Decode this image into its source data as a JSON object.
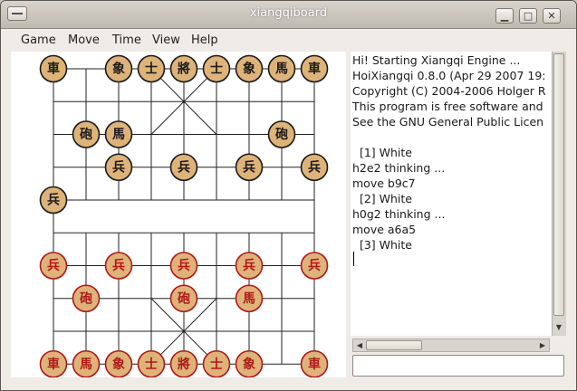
{
  "window": {
    "title": "xiangqiboard"
  },
  "menus": [
    "Game",
    "Move",
    "Time",
    "View",
    "Help"
  ],
  "title_buttons": {
    "minimize": "▁",
    "maximize": "□",
    "close": "✕"
  },
  "board": {
    "columns": 9,
    "rows": 10,
    "colors": {
      "piece_fill": "#deb37a",
      "black_side": "#1a1a1a",
      "red_side": "#b01818"
    },
    "black_pieces": [
      {
        "char": "車",
        "col": 0,
        "row": 0
      },
      {
        "char": "象",
        "col": 2,
        "row": 0
      },
      {
        "char": "士",
        "col": 3,
        "row": 0
      },
      {
        "char": "將",
        "col": 4,
        "row": 0
      },
      {
        "char": "士",
        "col": 5,
        "row": 0
      },
      {
        "char": "象",
        "col": 6,
        "row": 0
      },
      {
        "char": "馬",
        "col": 7,
        "row": 0
      },
      {
        "char": "車",
        "col": 8,
        "row": 0
      },
      {
        "char": "砲",
        "col": 1,
        "row": 2
      },
      {
        "char": "馬",
        "col": 2,
        "row": 2
      },
      {
        "char": "砲",
        "col": 7,
        "row": 2
      },
      {
        "char": "兵",
        "col": 2,
        "row": 3
      },
      {
        "char": "兵",
        "col": 4,
        "row": 3
      },
      {
        "char": "兵",
        "col": 6,
        "row": 3
      },
      {
        "char": "兵",
        "col": 8,
        "row": 3
      },
      {
        "char": "兵",
        "col": 0,
        "row": 4
      }
    ],
    "red_pieces": [
      {
        "char": "兵",
        "col": 0,
        "row": 6
      },
      {
        "char": "兵",
        "col": 2,
        "row": 6
      },
      {
        "char": "兵",
        "col": 4,
        "row": 6
      },
      {
        "char": "兵",
        "col": 6,
        "row": 6
      },
      {
        "char": "兵",
        "col": 8,
        "row": 6
      },
      {
        "char": "砲",
        "col": 1,
        "row": 7
      },
      {
        "char": "砲",
        "col": 4,
        "row": 7
      },
      {
        "char": "馬",
        "col": 6,
        "row": 7
      },
      {
        "char": "車",
        "col": 0,
        "row": 9
      },
      {
        "char": "馬",
        "col": 1,
        "row": 9
      },
      {
        "char": "象",
        "col": 2,
        "row": 9
      },
      {
        "char": "士",
        "col": 3,
        "row": 9
      },
      {
        "char": "將",
        "col": 4,
        "row": 9
      },
      {
        "char": "士",
        "col": 5,
        "row": 9
      },
      {
        "char": "象",
        "col": 6,
        "row": 9
      },
      {
        "char": "車",
        "col": 8,
        "row": 9
      }
    ]
  },
  "log": {
    "lines": [
      "Hi! Starting Xiangqi Engine ...",
      "HoiXiangqi 0.8.0 (Apr 29 2007 19:",
      "Copyright (C) 2004-2006 Holger R",
      "This program is free software and",
      "See the GNU General Public Licen",
      "",
      "  [1] White",
      "h2e2 thinking ...",
      "move b9c7",
      "  [2] White",
      "h0g2 thinking ...",
      "move a6a5",
      "  [3] White"
    ]
  },
  "scroll": {
    "up_arrow": "▲",
    "down_arrow": "▼",
    "left_arrow": "◀",
    "right_arrow": "▶"
  },
  "entry": {
    "value": ""
  }
}
